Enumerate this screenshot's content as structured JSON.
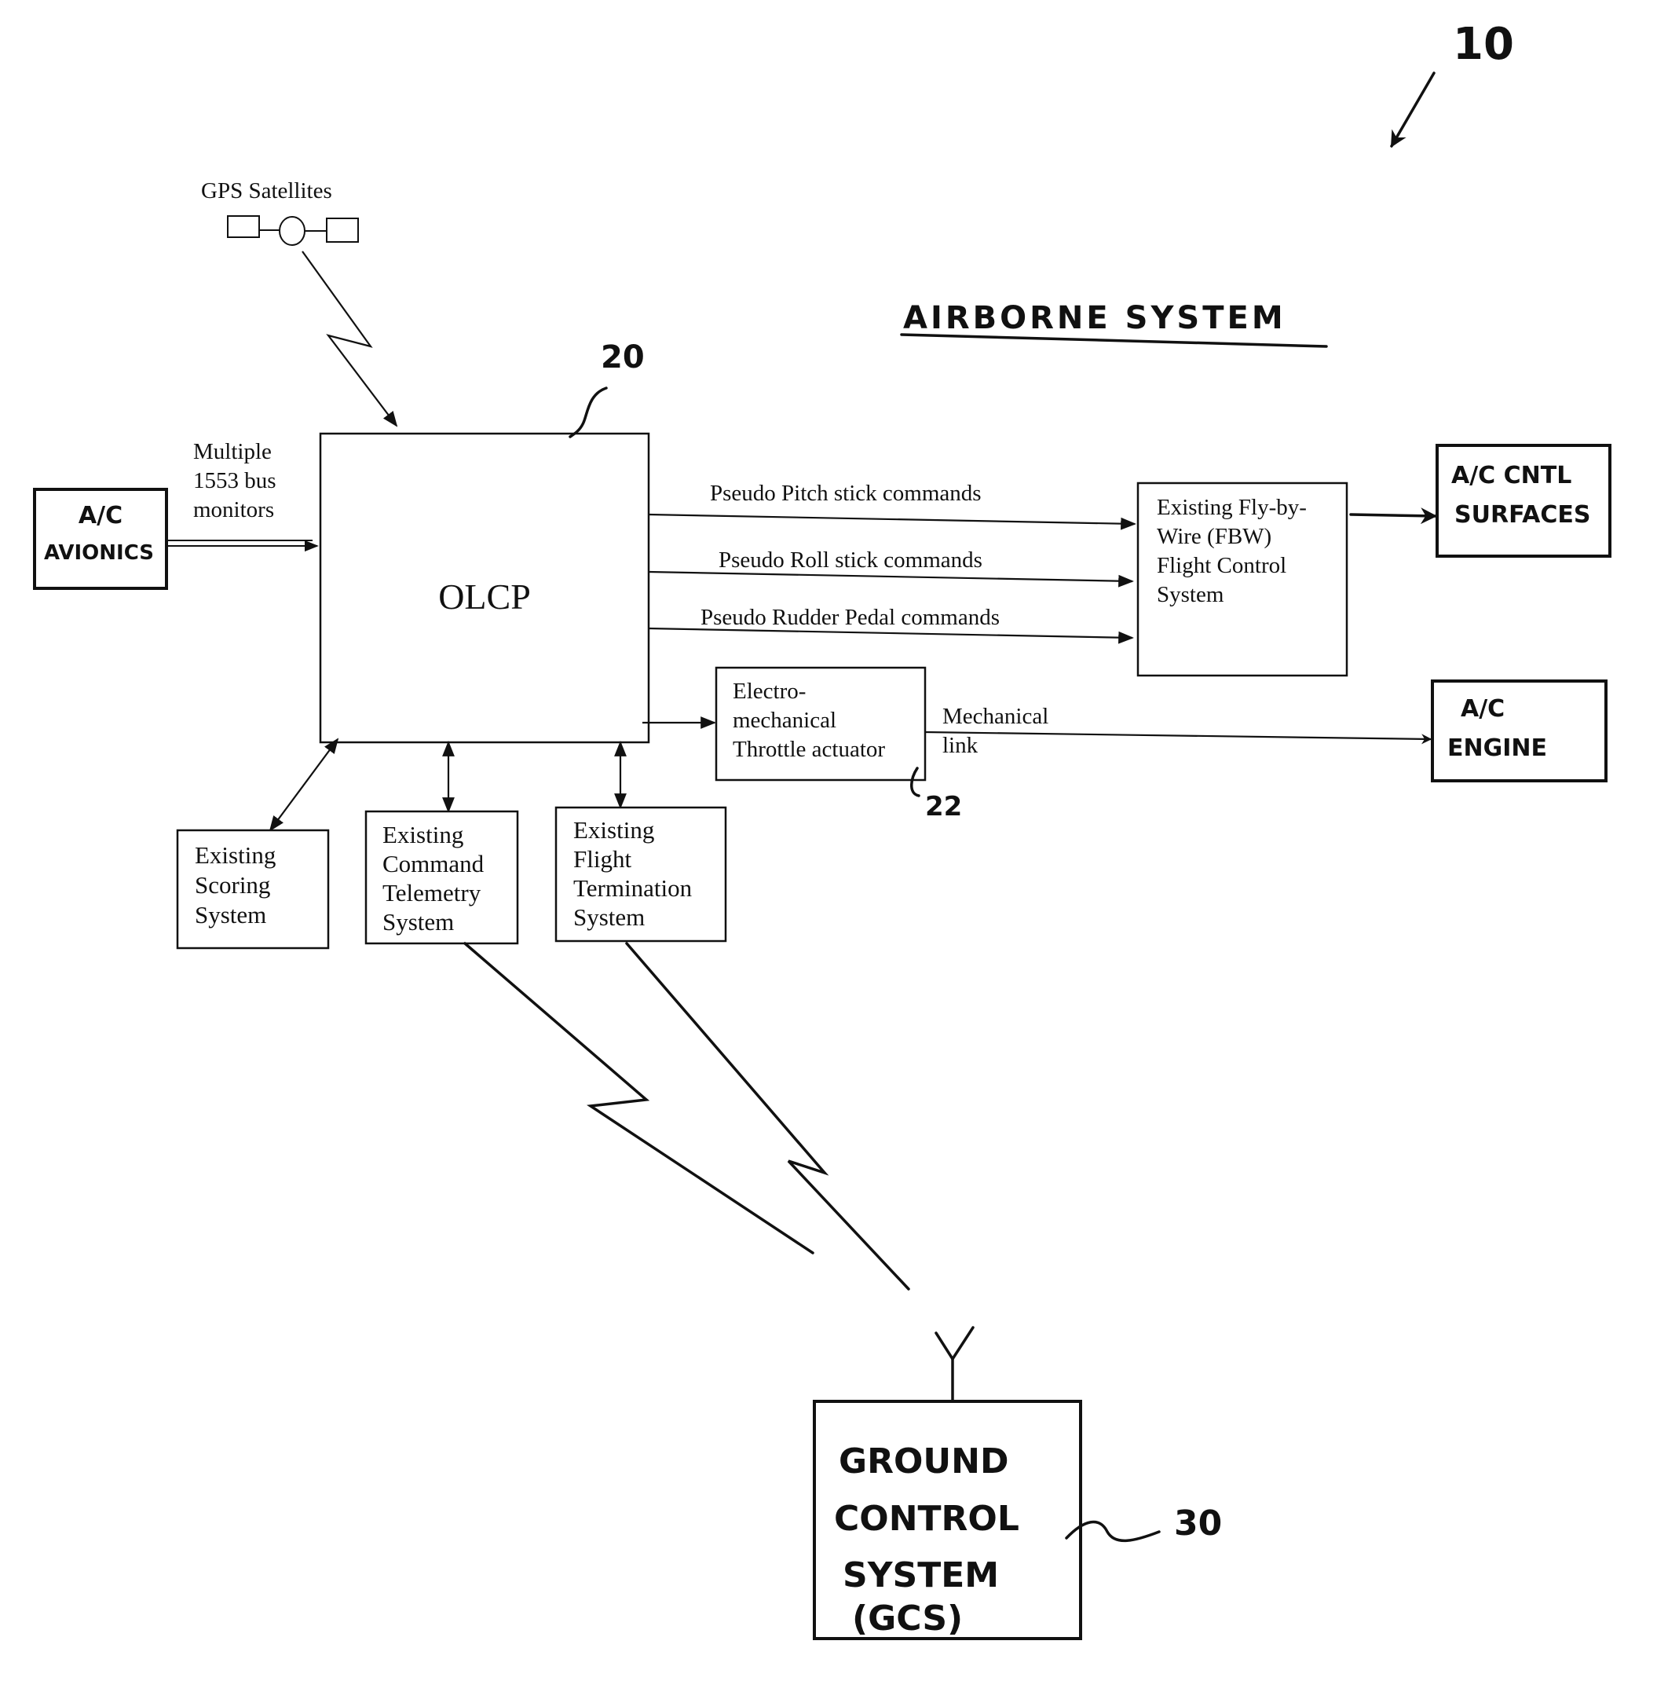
{
  "figure": {
    "reference_number": "10",
    "section_title": "AIRBORNE SYSTEM"
  },
  "gps": {
    "label": "GPS Satellites"
  },
  "olcp": {
    "label": "OLCP",
    "reference_number": "20"
  },
  "avionics": {
    "line1": "A/C",
    "line2": "AVIONICS",
    "link_label": [
      "Multiple",
      "1553 bus",
      "monitors"
    ]
  },
  "commands": [
    {
      "label": "Pseudo Pitch stick commands"
    },
    {
      "label": "Pseudo Roll stick commands"
    },
    {
      "label": "Pseudo Rudder Pedal commands"
    }
  ],
  "fbw": {
    "lines": [
      "Existing Fly-by-",
      "Wire (FBW)",
      "Flight Control",
      "System"
    ]
  },
  "control_surfaces": {
    "lines": [
      "A/C CNTL",
      "SURFACES"
    ]
  },
  "throttle": {
    "lines": [
      "Electro-",
      "mechanical",
      "Throttle actuator"
    ],
    "reference_number": "22",
    "link_label": [
      "Mechanical",
      "link"
    ]
  },
  "engine": {
    "lines": [
      "A/C",
      "ENGINE"
    ]
  },
  "subsystems": [
    {
      "lines": [
        "Existing",
        "Scoring",
        "System"
      ]
    },
    {
      "lines": [
        "Existing",
        "Command",
        "Telemetry",
        "System"
      ]
    },
    {
      "lines": [
        "Existing",
        "Flight",
        "Termination",
        "System"
      ]
    }
  ],
  "gcs": {
    "lines": [
      "GROUND",
      "CONTROL",
      "SYSTEM",
      "(GCS)"
    ],
    "reference_number": "30"
  }
}
